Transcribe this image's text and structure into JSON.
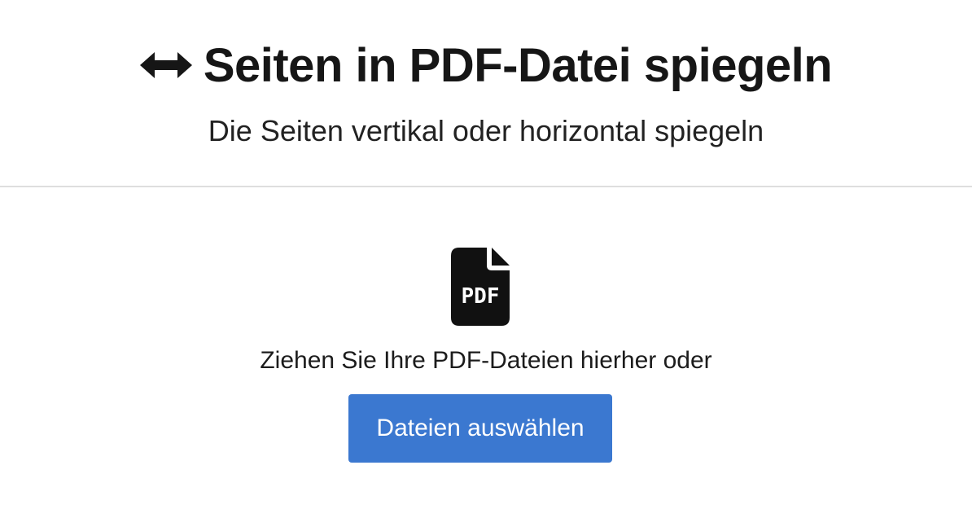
{
  "header": {
    "title": "Seiten in PDF-Datei spiegeln",
    "title_icon": "arrows-left-right-icon",
    "subtitle": "Die Seiten vertikal oder horizontal spiegeln"
  },
  "upload": {
    "file_icon": "file-pdf-icon",
    "file_icon_label": "PDF",
    "drop_text": "Ziehen Sie Ihre PDF-Dateien hierher oder",
    "button_label": "Dateien auswählen"
  },
  "colors": {
    "accent": "#3b78d0",
    "text": "#1a1a1a",
    "divider": "#dedede"
  }
}
